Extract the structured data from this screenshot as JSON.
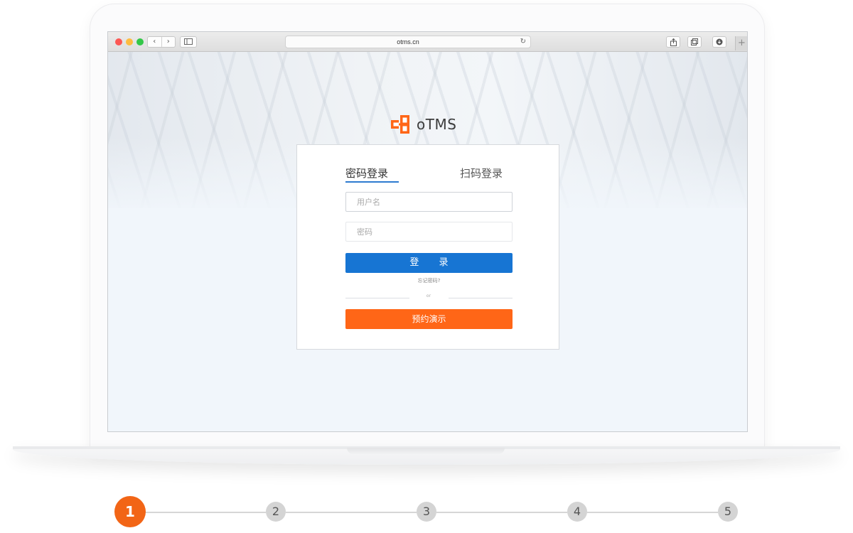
{
  "browser": {
    "url": "otms.cn",
    "reload_glyph": "↻",
    "new_tab_glyph": "+"
  },
  "brand": {
    "name": "oTMS",
    "logo_color": "#ff6617"
  },
  "login": {
    "tabs": [
      {
        "label": "密码登录",
        "active": true
      },
      {
        "label": "扫码登录",
        "active": false
      }
    ],
    "username_placeholder": "用户名",
    "password_placeholder": "密码",
    "login_button": "登 录",
    "forgot_link": "忘记密码?",
    "divider_text": "or",
    "demo_button": "预约演示",
    "primary_color": "#1775d3",
    "accent_color": "#ff6617"
  },
  "stepper": {
    "steps": [
      "1",
      "2",
      "3",
      "4",
      "5"
    ],
    "current": 1,
    "active_color": "#f26516"
  }
}
